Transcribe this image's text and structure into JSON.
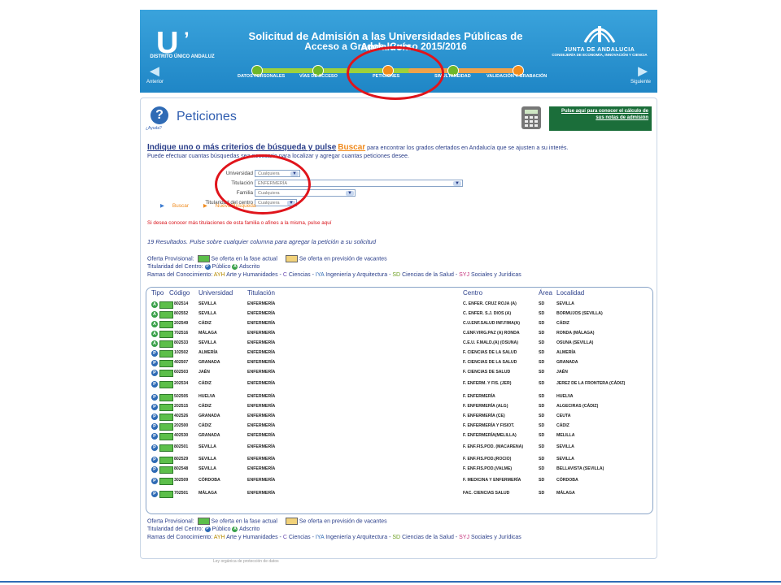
{
  "header": {
    "logo_title": "U",
    "logo_text": "DISTRITO ÚNICO ANDALUZ",
    "title": "Solicitud de Admisión a las Universidades Públicas de Andalucía",
    "subtitle": "Acceso a Grados. Curso 2015/2016",
    "junta_name": "JUNTA DE ANDALUCIA",
    "junta_consejeria": "CONSEJERÍA DE ECONOMÍA, INNOVACIÓN Y CIENCIA",
    "prev_label": "Anterior",
    "next_label": "Siguiente",
    "steps": [
      "DATOS PERSONALES",
      "VÍAS DE ACCESO",
      "PETICIONES",
      "SIMULTANEIDAD",
      "VALIDACIÓN Y GRABACIÓN"
    ],
    "active_step": "PETICIONES"
  },
  "main": {
    "help_label": "¿Ayuda?",
    "title": "Peticiones",
    "calc_link": "Pulse aquí para conocer el cálculo de sus notas de admisión",
    "instr_big": "Indique uno o más criterios de búsqueda y pulse",
    "instr_buscar": "Buscar",
    "instr_rest": "para encontrar los grados ofertados en Andalucía que se ajusten a su interés.",
    "instr_line2": "Puede efectuar cuantas búsquedas sea necesario para localizar y agregar cuantas peticiones desee.",
    "filters": [
      {
        "label": "Universidad",
        "value": "Cualquiera"
      },
      {
        "label": "Titulación",
        "value": "ENFERMERÍA"
      },
      {
        "label": "Familia",
        "value": "Cualquiera"
      },
      {
        "label": "Titularidad del centro",
        "value": "Cualquiera"
      }
    ],
    "buscar_btn": "Buscar",
    "nueva_btn": "Nueva Búsqueda",
    "more_info": "Si desea conocer más titulaciones de esta familia o afines a la misma, pulse aquí",
    "results_count": "19 Resultados.",
    "results_hint": "Pulse sobre cualquier columna para agregar la petición a su solicitud"
  },
  "legend": {
    "oferta_label": "Oferta Provisional:",
    "oferta_actual": "Se oferta en la fase actual",
    "oferta_prevision": "Se oferta en previsión de vacantes",
    "titularidad_label": "Titularidad del Centro:",
    "publico": "Público",
    "adscrito": "Adscrito",
    "ramas_label": "Ramas del Conocimiento:",
    "ramas": [
      {
        "code": "AYH",
        "name": "Arte y Humanidades"
      },
      {
        "code": "C",
        "name": "Ciencias"
      },
      {
        "code": "IYA",
        "name": "Ingeniería y Arquitectura"
      },
      {
        "code": "SD",
        "name": "Ciencias de la Salud"
      },
      {
        "code": "SYJ",
        "name": "Sociales y Jurídicas"
      }
    ]
  },
  "table": {
    "headers": {
      "tipo": "Tipo",
      "codigo": "Código",
      "universidad": "Universidad",
      "titulacion": "Titulación",
      "centro": "Centro",
      "area": "Área",
      "localidad": "Localidad"
    },
    "rows": [
      {
        "tipo": "A",
        "codigo": "802514",
        "universidad": "SEVILLA",
        "titulacion": "ENFERMERÍA",
        "centro": "C. ENFER. CRUZ ROJA (A)",
        "area": "SD",
        "localidad": "SEVILLA"
      },
      {
        "tipo": "A",
        "codigo": "802552",
        "universidad": "SEVILLA",
        "titulacion": "ENFERMERÍA",
        "centro": "C. ENFER. S.J. DIOS (A)",
        "area": "SD",
        "localidad": "BORMUJOS (SEVILLA)"
      },
      {
        "tipo": "A",
        "codigo": "202549",
        "universidad": "CÁDIZ",
        "titulacion": "ENFERMERÍA",
        "centro": "C.U.ENF.SALUD INF.FIMA(A)",
        "area": "SD",
        "localidad": "CÁDIZ"
      },
      {
        "tipo": "A",
        "codigo": "702516",
        "universidad": "MÁLAGA",
        "titulacion": "ENFERMERÍA",
        "centro": "C.ENF.VIRG.PAZ (A) RONDA",
        "area": "SD",
        "localidad": "RONDA (MÁLAGA)"
      },
      {
        "tipo": "A",
        "codigo": "802533",
        "universidad": "SEVILLA",
        "titulacion": "ENFERMERÍA",
        "centro": "C.E.U. F.MALD.(A) (OSUNA)",
        "area": "SD",
        "localidad": "OSUNA (SEVILLA)"
      },
      {
        "tipo": "P",
        "codigo": "102502",
        "universidad": "ALMERÍA",
        "titulacion": "ENFERMERÍA",
        "centro": "F. CIENCIAS DE LA SALUD",
        "area": "SD",
        "localidad": "ALMERÍA"
      },
      {
        "tipo": "P",
        "codigo": "402507",
        "universidad": "GRANADA",
        "titulacion": "ENFERMERÍA",
        "centro": "F. CIENCIAS DE LA SALUD",
        "area": "SD",
        "localidad": "GRANADA"
      },
      {
        "tipo": "P",
        "codigo": "602503",
        "universidad": "JAÉN",
        "titulacion": "ENFERMERÍA",
        "centro": "F. CIENCIAS DE SALUD",
        "area": "SD",
        "localidad": "JAÉN"
      },
      {
        "tipo": "P",
        "codigo": "202534",
        "universidad": "CÁDIZ",
        "titulacion": "ENFERMERÍA",
        "centro": "F. ENFERM. Y FIS. (JER)",
        "area": "SD",
        "localidad": "JEREZ DE LA FRONTERA (CÁDIZ)"
      },
      {
        "tipo": "P",
        "codigo": "502505",
        "universidad": "HUELVA",
        "titulacion": "ENFERMERÍA",
        "centro": "F. ENFERMERÍA",
        "area": "SD",
        "localidad": "HUELVA"
      },
      {
        "tipo": "P",
        "codigo": "202515",
        "universidad": "CÁDIZ",
        "titulacion": "ENFERMERÍA",
        "centro": "F. ENFERMERÍA (ALG)",
        "area": "SD",
        "localidad": "ALGECIRAS (CÁDIZ)"
      },
      {
        "tipo": "P",
        "codigo": "402526",
        "universidad": "GRANADA",
        "titulacion": "ENFERMERÍA",
        "centro": "F. ENFERMERÍA (CE)",
        "area": "SD",
        "localidad": "CEUTA"
      },
      {
        "tipo": "P",
        "codigo": "202500",
        "universidad": "CÁDIZ",
        "titulacion": "ENFERMERÍA",
        "centro": "F. ENFERMERÍA Y FISIOT.",
        "area": "SD",
        "localidad": "CÁDIZ"
      },
      {
        "tipo": "P",
        "codigo": "402530",
        "universidad": "GRANADA",
        "titulacion": "ENFERMERÍA",
        "centro": "F. ENFERMERÍA(MELILLA)",
        "area": "SD",
        "localidad": "MELILLA"
      },
      {
        "tipo": "P",
        "codigo": "802501",
        "universidad": "SEVILLA",
        "titulacion": "ENFERMERÍA",
        "centro": "F. ENF.FIS.POD. (MACARENA)",
        "area": "SD",
        "localidad": "SEVILLA"
      },
      {
        "tipo": "P",
        "codigo": "802529",
        "universidad": "SEVILLA",
        "titulacion": "ENFERMERÍA",
        "centro": "F. ENF.FIS.POD.(ROCIO)",
        "area": "SD",
        "localidad": "SEVILLA"
      },
      {
        "tipo": "P",
        "codigo": "802548",
        "universidad": "SEVILLA",
        "titulacion": "ENFERMERÍA",
        "centro": "F. ENF.FIS.POD.(VALME)",
        "area": "SD",
        "localidad": "BELLAVISTA (SEVILLA)"
      },
      {
        "tipo": "P",
        "codigo": "302509",
        "universidad": "CÓRDOBA",
        "titulacion": "ENFERMERÍA",
        "centro": "F. MEDICINA Y ENFERMERÍA",
        "area": "SD",
        "localidad": "CÓRDOBA"
      },
      {
        "tipo": "P",
        "codigo": "702501",
        "universidad": "MÁLAGA",
        "titulacion": "ENFERMERÍA",
        "centro": "FAC. CIENCIAS SALUD",
        "area": "SD",
        "localidad": "MÁLAGA"
      }
    ]
  },
  "footer": {
    "text": "Ley orgánica de protección de datos"
  },
  "colors": {
    "header_blue": "#1f86c6",
    "accent_orange": "#f08a1c",
    "link_blue": "#2b3f8a",
    "green_offer": "#5cbf4a",
    "annotation_red": "#e0141b"
  },
  "icons": {
    "help": "help-icon",
    "calculator": "calculator-icon",
    "prev": "arrow-left-icon",
    "next": "arrow-right-icon"
  }
}
